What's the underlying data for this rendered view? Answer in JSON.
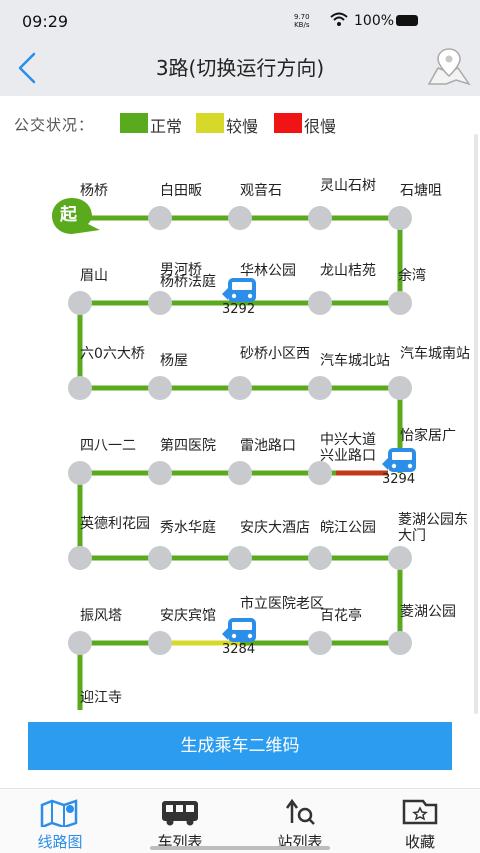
{
  "status": {
    "time": "09:29",
    "speed_value": "9.70",
    "speed_unit": "KB/s",
    "battery": "100%"
  },
  "header": {
    "title": "3路(切换运行方向)",
    "back_icon": "back-chevron-icon",
    "map_icon": "map-pin-icon"
  },
  "legend": {
    "label": "公交状况：",
    "items": [
      {
        "text": "正常",
        "color": "#5aaa1e"
      },
      {
        "text": "较慢",
        "color": "#d7d92a"
      },
      {
        "text": "很慢",
        "color": "#f01414"
      }
    ]
  },
  "route": {
    "start_badge": "起",
    "stops": [
      "杨桥",
      "白田畈",
      "观音石",
      "灵山石树",
      "石塘咀",
      "余湾",
      "龙山桔苑",
      "华林公园",
      "杨桥法庭",
      "男河桥",
      "眉山",
      "六0六大桥",
      "杨屋",
      "砂桥小区西",
      "汽车城北站",
      "汽车城南站",
      "怡家居广",
      "中兴大道兴业路口",
      "雷池路口",
      "第四医院",
      "四八一二",
      "英德利花园",
      "秀水华庭",
      "安庆大酒店",
      "皖江公园",
      "菱湖公园东大门",
      "菱湖公园",
      "百花亭",
      "市立医院老区",
      "安庆宾馆",
      "振风塔",
      "迎江寺"
    ],
    "buses": [
      "3292",
      "3294",
      "3284"
    ],
    "segment_status_colors": {
      "normal": "#5aaa1e",
      "slow": "#d7d92a",
      "very_slow": "#c0391b"
    }
  },
  "actions": {
    "qr_button": "生成乘车二维码"
  },
  "tabs": [
    {
      "label": "线路图",
      "icon": "map-route-icon",
      "active": true
    },
    {
      "label": "车列表",
      "icon": "bus-icon",
      "active": false
    },
    {
      "label": "站列表",
      "icon": "station-search-icon",
      "active": false
    },
    {
      "label": "收藏",
      "icon": "favorites-icon",
      "active": false
    }
  ]
}
